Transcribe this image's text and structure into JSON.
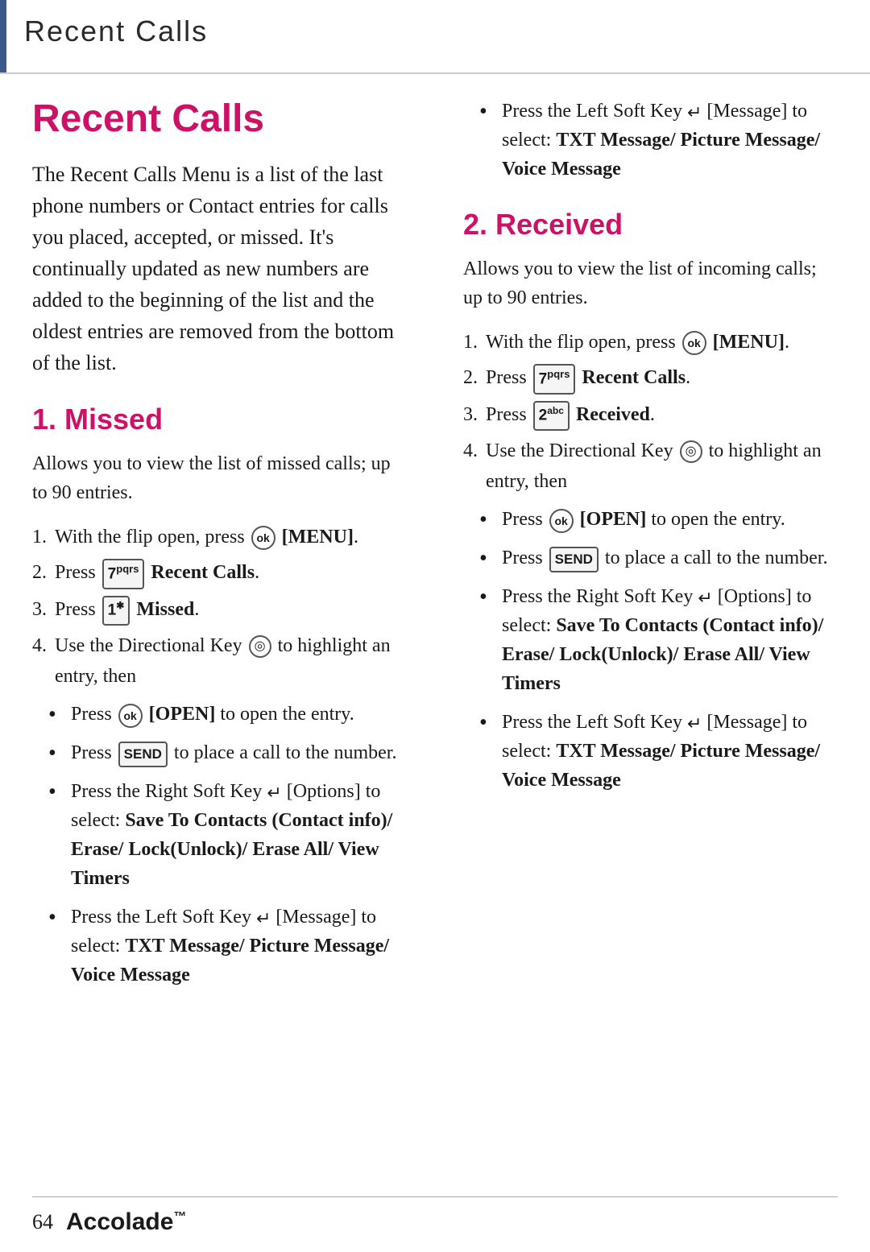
{
  "header": {
    "title": "Recent Calls",
    "accent_color": "#3a5a8a"
  },
  "page": {
    "title": "Recent Calls",
    "intro": "The Recent Calls Menu is a list of the last phone numbers or Contact entries for calls you placed, accepted, or missed. It's continually updated as new numbers are added to the beginning of the list and the oldest entries are removed from the bottom of the list."
  },
  "section1": {
    "heading": "1. Missed",
    "intro": "Allows you to view the list of missed calls; up to 90 entries.",
    "steps": [
      "With the flip open, press [OK] [MENU].",
      "Press [7pqrs] Recent Calls.",
      "Press [1] Missed.",
      "Use the Directional Key to highlight an entry, then"
    ],
    "bullets": [
      {
        "text": "Press [OK] [OPEN] to open the entry."
      },
      {
        "text": "Press [SEND] to place a call to the number."
      },
      {
        "text": "Press the Right Soft Key [Options] to select: Save To Contacts (Contact info)/ Erase/ Lock(Unlock)/ Erase All/ View Timers",
        "bold_part": "Save To Contacts (Contact info)/ Erase/ Lock(Unlock)/ Erase All/ View Timers"
      },
      {
        "text": "Press the Left Soft Key [Message] to select: TXT Message/ Picture Message/ Voice Message",
        "bold_part": "TXT Message/ Picture Message/ Voice Message"
      }
    ]
  },
  "section2": {
    "heading": "2. Received",
    "intro": "Allows you to view the list of incoming calls; up to 90 entries.",
    "right_col_bullet1": {
      "text": "Press the Left Soft Key [Message] to select: TXT Message/ Picture Message/ Voice Message",
      "bold_part": "TXT Message/ Picture Message/ Voice Message"
    },
    "steps": [
      "With the flip open, press [OK] [MENU].",
      "Press [7pqrs] Recent Calls.",
      "Press [2abc] Received.",
      "Use the Directional Key to highlight an entry, then"
    ],
    "bullets": [
      {
        "text": "Press [OK] [OPEN] to open the entry."
      },
      {
        "text": "Press [SEND] to place a call to the number."
      },
      {
        "text": "Press the Right Soft Key [Options] to select: Save To Contacts (Contact info)/ Erase/ Lock(Unlock)/ Erase All/ View Timers",
        "bold_part": "Save To Contacts (Contact info)/ Erase/ Lock(Unlock)/ Erase All/ View Timers"
      },
      {
        "text": "Press the Left Soft Key [Message] to select: TXT Message/ Picture Message/ Voice Message",
        "bold_part": "TXT Message/ Picture Message/ Voice Message"
      }
    ]
  },
  "footer": {
    "page_number": "64",
    "brand": "Accolade"
  }
}
